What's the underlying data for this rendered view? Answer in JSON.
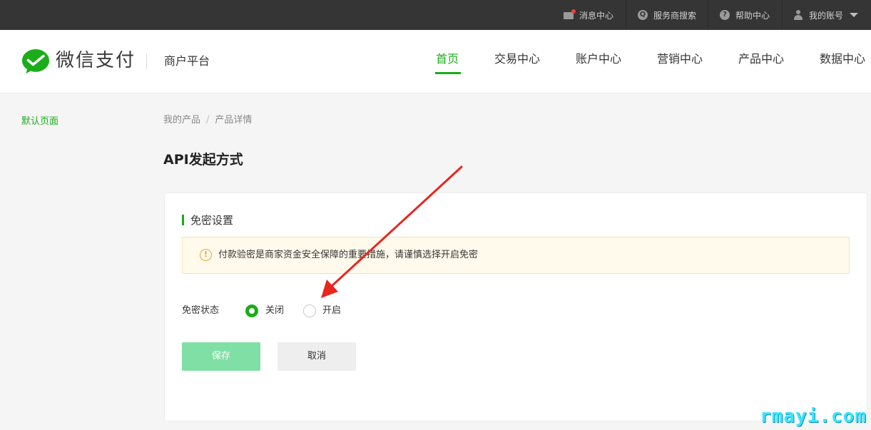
{
  "topbar": {
    "messages": "消息中心",
    "provider_search": "服务商搜索",
    "help": "帮助中心",
    "account": "我的账号"
  },
  "header": {
    "brand": "微信支付",
    "platform": "商户平台",
    "nav": [
      "首页",
      "交易中心",
      "账户中心",
      "营销中心",
      "产品中心",
      "数据中心"
    ]
  },
  "side": {
    "item": "默认页面"
  },
  "breadcrumb": [
    "我的产品",
    "产品详情"
  ],
  "breadcrumb_sep": "/",
  "page_title": "API发起方式",
  "section": {
    "title": "免密设置",
    "notice": "付款验密是商家资金安全保障的重要措施，请谨慎选择开启免密",
    "status_label": "免密状态",
    "option_off": "关闭",
    "option_on": "开启",
    "selected": "关闭"
  },
  "buttons": {
    "save": "保存",
    "cancel": "取消"
  },
  "colors": {
    "brand_green": "#1aad19",
    "topbar": "#353535",
    "save_disabled": "#80dfa4",
    "annotation_red": "#e8261d"
  },
  "watermark": "rmayi.com"
}
